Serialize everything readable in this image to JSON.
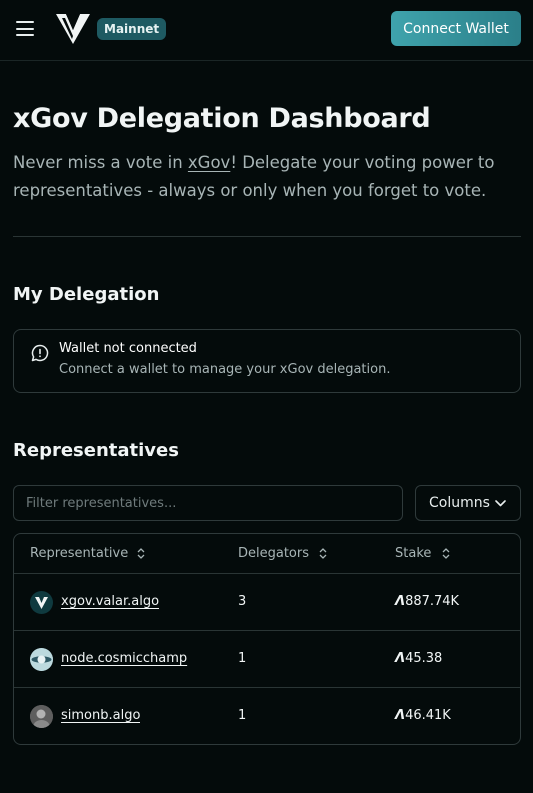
{
  "header": {
    "network_badge": "Mainnet",
    "connect_button": "Connect Wallet"
  },
  "hero": {
    "title": "xGov Delegation Dashboard",
    "subtitle_before": "Never miss a vote in ",
    "subtitle_link": "xGov",
    "subtitle_after": "! Delegate your voting power to representatives - always or only when you forget to vote."
  },
  "delegation": {
    "heading": "My Delegation",
    "alert_title": "Wallet not connected",
    "alert_message": "Connect a wallet to manage your xGov delegation."
  },
  "representatives": {
    "heading": "Representatives",
    "filter_placeholder": "Filter representatives...",
    "columns_button": "Columns",
    "table": {
      "headers": [
        "Representative",
        "Delegators",
        "Stake"
      ],
      "rows": [
        {
          "name": "xgov.valar.algo",
          "delegators": "3",
          "stake": "887.74K",
          "avatar": "valar-logo-icon"
        },
        {
          "name": "node.cosmicchamp",
          "delegators": "1",
          "stake": "45.38",
          "avatar": "cosmic-avatar-icon"
        },
        {
          "name": "simonb.algo",
          "delegators": "1",
          "stake": "46.41K",
          "avatar": "photo-avatar-icon"
        }
      ]
    },
    "currency_symbol": "Ȃ"
  },
  "colors": {
    "background": "#040b0b",
    "accent": "#3fa3ac",
    "badge": "#1e5a62",
    "border": "#2f3a3b",
    "muted_text": "#a8b5b6"
  }
}
